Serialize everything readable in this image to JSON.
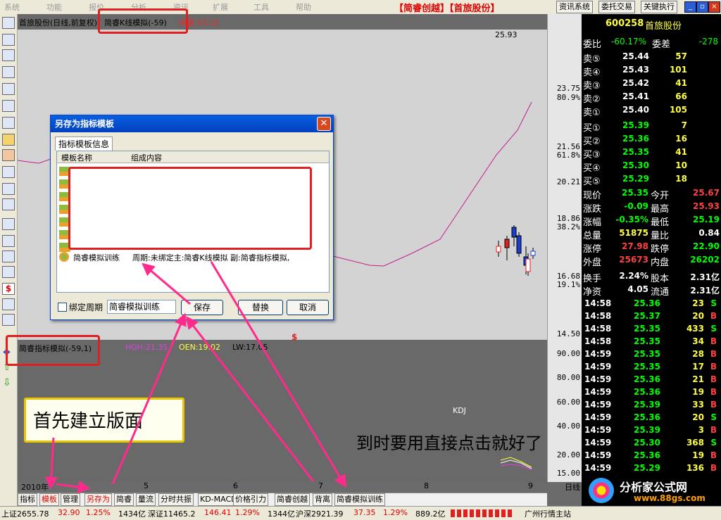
{
  "menu": [
    "系统",
    "功能",
    "报价",
    "分析",
    "资讯",
    "工具",
    "扩展",
    "帮助"
  ],
  "app_title": "【简睿创越】【首旅股份】",
  "top_buttons": [
    "资讯系统",
    "委托交易",
    "关键执行"
  ],
  "chart": {
    "stock_label": "首旅股份(日线,前复权)",
    "indicator_main": "简睿K线模拟(-59)",
    "indicator_value": "简睿:23.22",
    "peak_label": "25.93",
    "y_labels": [
      "23.75",
      "80.9%",
      "21.56",
      "61.8%",
      "20.21",
      "18.86",
      "38.2%",
      "16.68",
      "19.1%",
      "14.50"
    ],
    "sub_indicator": "简睿指标模拟(-59,1)",
    "sub_values": [
      "HGH:21.35",
      "OEN:19.02",
      "LW:17.05"
    ],
    "sub_y_labels": [
      "90.00",
      "80.00",
      "60.00",
      "40.00",
      "20.00",
      "15.00"
    ],
    "kdj_label": "KDJ",
    "x_labels": [
      "2010年",
      "5",
      "6",
      "7",
      "8",
      "9",
      "日线"
    ]
  },
  "quote": {
    "code": "600258",
    "name": "首旅股份",
    "weibi_label": "委比",
    "weibi_value": "-60.17%",
    "weicha_label": "委差",
    "weicha_value": "-278",
    "sells": [
      {
        "label": "卖⑤",
        "price": "25.44",
        "vol": "57"
      },
      {
        "label": "卖④",
        "price": "25.43",
        "vol": "101"
      },
      {
        "label": "卖③",
        "price": "25.42",
        "vol": "41"
      },
      {
        "label": "卖②",
        "price": "25.41",
        "vol": "66"
      },
      {
        "label": "卖①",
        "price": "25.40",
        "vol": "105"
      }
    ],
    "buys": [
      {
        "label": "买①",
        "price": "25.39",
        "vol": "7"
      },
      {
        "label": "买②",
        "price": "25.36",
        "vol": "16"
      },
      {
        "label": "买③",
        "price": "25.35",
        "vol": "41"
      },
      {
        "label": "买④",
        "price": "25.30",
        "vol": "10"
      },
      {
        "label": "买⑤",
        "price": "25.29",
        "vol": "18"
      }
    ],
    "stats": [
      {
        "l1": "现价",
        "v1": "25.35",
        "l2": "今开",
        "v2": "25.67"
      },
      {
        "l1": "涨跌",
        "v1": "-0.09",
        "l2": "最高",
        "v2": "25.93"
      },
      {
        "l1": "涨幅",
        "v1": "-0.35%",
        "l2": "最低",
        "v2": "25.19"
      },
      {
        "l1": "总量",
        "v1": "51875",
        "l2": "量比",
        "v2": "0.84"
      },
      {
        "l1": "涨停",
        "v1": "27.98",
        "l2": "跌停",
        "v2": "22.90"
      },
      {
        "l1": "外盘",
        "v1": "25673",
        "l2": "内盘",
        "v2": "26202"
      },
      {
        "l1": "换手",
        "v1": "2.24%",
        "l2": "股本",
        "v2": "2.31亿"
      },
      {
        "l1": "净资",
        "v1": "4.05",
        "l2": "流通",
        "v2": "2.31亿"
      }
    ],
    "ticks": [
      {
        "time": "14:58",
        "price": "25.36",
        "vol": "23",
        "side": "S"
      },
      {
        "time": "14:58",
        "price": "25.37",
        "vol": "20",
        "side": "B"
      },
      {
        "time": "14:58",
        "price": "25.35",
        "vol": "433",
        "side": "S"
      },
      {
        "time": "14:58",
        "price": "25.35",
        "vol": "34",
        "side": "B"
      },
      {
        "time": "14:59",
        "price": "25.35",
        "vol": "28",
        "side": "B"
      },
      {
        "time": "14:59",
        "price": "25.35",
        "vol": "17",
        "side": "B"
      },
      {
        "time": "14:59",
        "price": "25.36",
        "vol": "21",
        "side": "B"
      },
      {
        "time": "14:59",
        "price": "25.36",
        "vol": "19",
        "side": "B"
      },
      {
        "time": "14:59",
        "price": "25.39",
        "vol": "33",
        "side": "B"
      },
      {
        "time": "14:59",
        "price": "25.36",
        "vol": "20",
        "side": "S"
      },
      {
        "time": "14:59",
        "price": "25.39",
        "vol": "3",
        "side": "B"
      },
      {
        "time": "14:59",
        "price": "25.30",
        "vol": "368",
        "side": "S"
      },
      {
        "time": "14:59",
        "price": "25.36",
        "vol": "19",
        "side": "B"
      },
      {
        "time": "14:59",
        "price": "25.29",
        "vol": "136",
        "side": "B"
      }
    ]
  },
  "tabs": [
    "指标",
    "模板",
    "管理",
    "另存为",
    "简睿",
    "量流",
    "分时共振",
    "KD-MACD",
    "价格引力",
    "简睿创越",
    "背离",
    "简睿模拟训练"
  ],
  "status": {
    "sh": "上证2655.78",
    "sh_chg": "32.90",
    "sh_pct": "1.25%",
    "sh_amt": "1434亿",
    "sz": "深证11465.2",
    "sz_chg": "146.41",
    "sz_pct": "1.29%",
    "sz_amt": "1344亿",
    "hs": "沪深2921.39",
    "hs_chg": "37.35",
    "hs_pct": "1.29%",
    "hs_amt": "889.2亿",
    "station": "广州行情主站"
  },
  "dialog": {
    "title": "另存为指标模板",
    "tab": "指标模板信息",
    "col1": "模板名称",
    "col2": "组成内容",
    "row_name": "简睿模拟训练",
    "row_content": "周期:未绑定主:简睿K线模拟 副:简睿指标模拟,",
    "bind_label": "绑定周期",
    "name_value": "简睿模拟训练",
    "save": "保存",
    "replace": "替换",
    "cancel": "取消"
  },
  "annotations": {
    "first": "首先建立版面",
    "second": "到时要用直接点击就好了"
  },
  "watermark": {
    "name": "分析家公式网",
    "url": "www.88gs.com"
  }
}
